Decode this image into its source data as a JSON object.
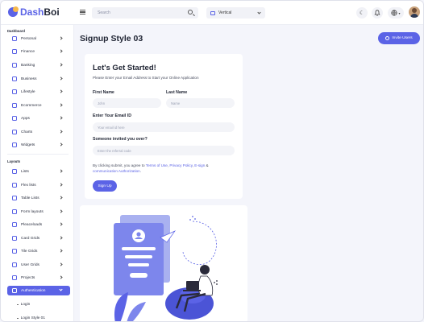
{
  "brand": {
    "name_accent": "Dash",
    "name_rest": "Boi"
  },
  "header": {
    "search_placeholder": "Search",
    "layout_value": "Vertical"
  },
  "sidebar": {
    "dashboard_title": "Dashboard",
    "dashboard_items": [
      {
        "label": "Personal"
      },
      {
        "label": "Finance"
      },
      {
        "label": "Banking"
      },
      {
        "label": "Business"
      },
      {
        "label": "Lifestyle"
      },
      {
        "label": "Ecommerce"
      },
      {
        "label": "Apps"
      },
      {
        "label": "Charts"
      },
      {
        "label": "Widgets"
      }
    ],
    "layouts_title": "Layouts",
    "layout_items": [
      {
        "label": "Lists"
      },
      {
        "label": "Flex lists"
      },
      {
        "label": "Table Lists"
      },
      {
        "label": "Form layouts"
      },
      {
        "label": "Pleaceloads"
      },
      {
        "label": "Card Grids"
      },
      {
        "label": "Tile Grids"
      },
      {
        "label": "User Grids"
      },
      {
        "label": "Projects"
      },
      {
        "label": "Authentication"
      }
    ],
    "sub_items": [
      {
        "label": "Login"
      },
      {
        "label": "Login Style 01"
      }
    ]
  },
  "main": {
    "page_title": "Signup Style 03",
    "invite_label": "Invite Users",
    "card": {
      "heading": "Let's Get Started!",
      "subtitle": "Please Enter your Email Address to Start your Online Application",
      "first_name_label": "First Name",
      "first_name_placeholder": "John",
      "last_name_label": "Last Name",
      "last_name_placeholder": "Name",
      "email_label": "Enter Your Email ID",
      "email_placeholder": "Your email id here",
      "referral_label": "Someone invited you over?",
      "referral_placeholder": "Enter the referral code",
      "terms_prefix": "By clicking submit, you agree to ",
      "terms_link1": "Terms of Use",
      "terms_sep1": ", ",
      "terms_link2": "Privacy Policy",
      "terms_sep2": ", ",
      "terms_link3": "E-sign",
      "terms_sep3": " & ",
      "terms_link4": "communication Authorization",
      "terms_end": ".",
      "signup_label": "Sign Up"
    }
  },
  "colors": {
    "accent": "#5b63e6",
    "background": "#f4f5fb",
    "illustration_light": "#a9b1f0"
  },
  "icons": [
    "menu-icon",
    "search-icon",
    "layout-icon",
    "moon-icon",
    "bell-icon",
    "globe-icon",
    "user-plus-icon"
  ]
}
